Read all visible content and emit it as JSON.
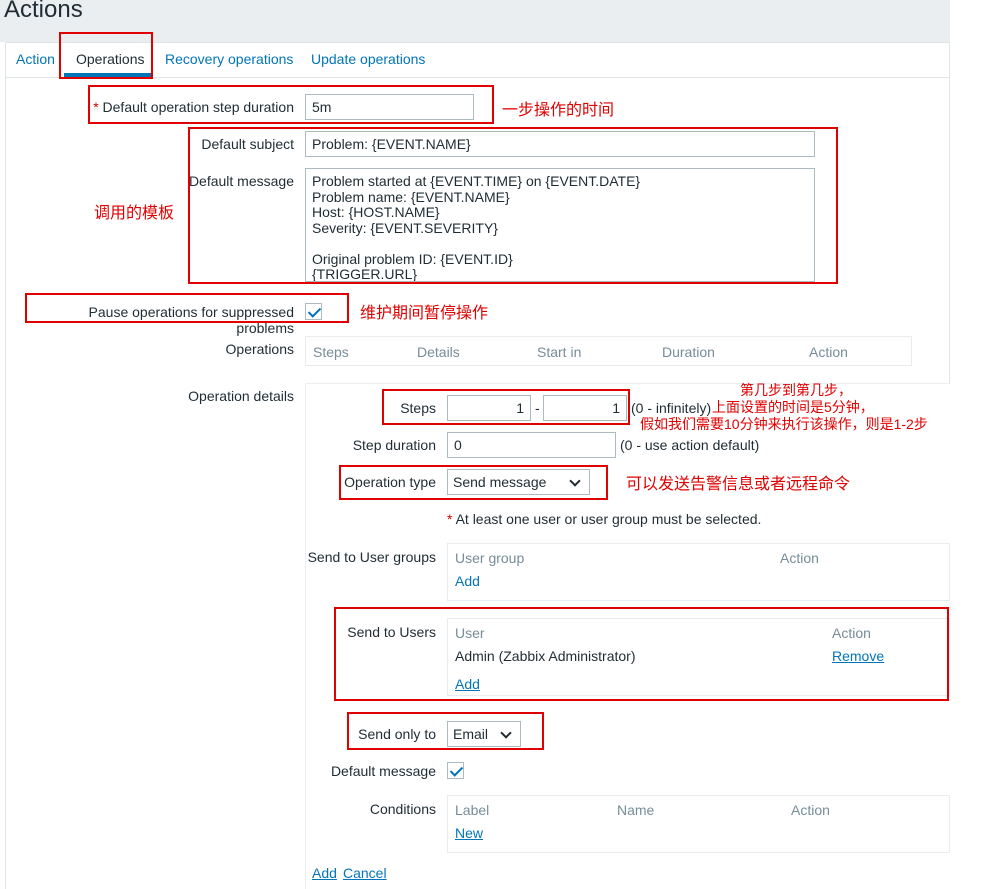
{
  "header": {
    "title": "Actions"
  },
  "tabs": [
    {
      "label": "Action"
    },
    {
      "label": "Operations",
      "active": true
    },
    {
      "label": "Recovery operations"
    },
    {
      "label": "Update operations"
    }
  ],
  "form": {
    "step_duration": {
      "label": "Default operation step duration",
      "value": "5m",
      "required_mark": "*"
    },
    "subject": {
      "label": "Default subject",
      "value": "Problem: {EVENT.NAME}"
    },
    "message": {
      "label": "Default message",
      "value": "Problem started at {EVENT.TIME} on {EVENT.DATE}\nProblem name: {EVENT.NAME}\nHost: {HOST.NAME}\nSeverity: {EVENT.SEVERITY}\n\nOriginal problem ID: {EVENT.ID}\n{TRIGGER.URL}"
    },
    "pause": {
      "label": "Pause operations for suppressed problems",
      "checked": true
    },
    "operations": {
      "label": "Operations",
      "columns": [
        "Steps",
        "Details",
        "Start in",
        "Duration",
        "Action"
      ]
    },
    "details": {
      "label": "Operation details",
      "steps": {
        "label": "Steps",
        "from": "1",
        "separator": "-",
        "to": "1",
        "hint": "(0 - infinitely)"
      },
      "step_duration": {
        "label": "Step duration",
        "value": "0",
        "hint": "(0 - use action default)"
      },
      "operation_type": {
        "label": "Operation type",
        "value": "Send message"
      },
      "warning": {
        "mark": "*",
        "text": "At least one user or user group must be selected."
      },
      "user_groups": {
        "label": "Send to User groups",
        "columns": [
          "User group",
          "Action"
        ],
        "add": "Add"
      },
      "users": {
        "label": "Send to Users",
        "columns": [
          "User",
          "Action"
        ],
        "rows": [
          {
            "user": "Admin (Zabbix Administrator)",
            "action": "Remove"
          }
        ],
        "add": "Add"
      },
      "send_only_to": {
        "label": "Send only to",
        "value": "Email"
      },
      "default_message": {
        "label": "Default message",
        "checked": true
      },
      "conditions": {
        "label": "Conditions",
        "columns": [
          "Label",
          "Name",
          "Action"
        ],
        "new": "New"
      },
      "add": "Add",
      "cancel": "Cancel"
    }
  },
  "annotations": {
    "step_time": "一步操作的时间",
    "template": "调用的模板",
    "maintenance": "维护期间暂停操作",
    "steps_line1": "第几步到第几步，",
    "steps_line2": "上面设置的时间是5分钟，",
    "steps_line3": "假如我们需要10分钟来执行该操作，则是1-2步",
    "op_type": "可以发送告警信息或者远程命令"
  },
  "colors": {
    "link": "#0275b8",
    "annotation": "#e00000",
    "background": "#ebeef0"
  }
}
